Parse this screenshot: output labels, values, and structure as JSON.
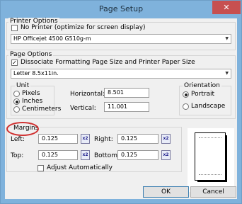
{
  "window": {
    "title": "Page Setup",
    "close_label": "✕"
  },
  "printer_options": {
    "legend": "Printer Options",
    "no_printer_label": "No Printer (optimize for screen display)",
    "no_printer_checked": false,
    "printer_value": "HP Officejet 4500 G510g-m"
  },
  "page_options": {
    "legend": "Page Options",
    "dissociate_label": "Dissociate Formatting Page Size and Printer Paper Size",
    "dissociate_checked": true,
    "paper_size_value": "Letter 8.5x11in.",
    "unit": {
      "legend": "Unit",
      "options": [
        "Pixels",
        "Inches",
        "Centimeters"
      ],
      "selected": "Inches"
    },
    "horizontal_label": "Horizontal:",
    "horizontal_value": "8.501",
    "vertical_label": "Vertical:",
    "vertical_value": "11.001",
    "orientation": {
      "legend": "Orientation",
      "options": [
        "Portrait",
        "Landscape"
      ],
      "selected": "Portrait"
    }
  },
  "margins": {
    "legend": "Margins",
    "left_label": "Left:",
    "left_value": "0.125",
    "right_label": "Right:",
    "right_value": "0.125",
    "top_label": "Top:",
    "top_value": "0.125",
    "bottom_label": "Bottom:",
    "bottom_value": "0.125",
    "adjust_label": "Adjust Automatically",
    "adjust_checked": false,
    "spin_icon_text": "x2"
  },
  "buttons": {
    "ok": "OK",
    "cancel": "Cancel"
  },
  "colors": {
    "titlebar": "#7fb2dc",
    "close": "#c75050",
    "highlight_ellipse": "#d03030"
  }
}
